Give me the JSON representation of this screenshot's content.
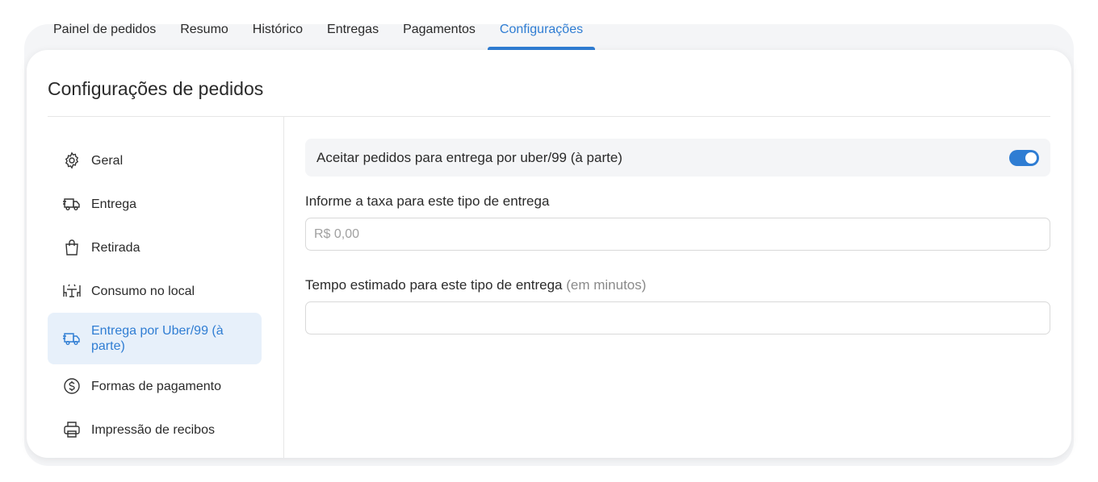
{
  "tabs": [
    {
      "label": "Painel de pedidos",
      "active": false
    },
    {
      "label": "Resumo",
      "active": false
    },
    {
      "label": "Histórico",
      "active": false
    },
    {
      "label": "Entregas",
      "active": false
    },
    {
      "label": "Pagamentos",
      "active": false
    },
    {
      "label": "Configurações",
      "active": true
    }
  ],
  "page": {
    "title": "Configurações de pedidos"
  },
  "menu": [
    {
      "label": "Geral",
      "icon": "gear-icon"
    },
    {
      "label": "Entrega",
      "icon": "delivery-truck-icon"
    },
    {
      "label": "Retirada",
      "icon": "shopping-bag-icon"
    },
    {
      "label": "Consumo no local",
      "icon": "table-chairs-icon"
    },
    {
      "label": "Entrega por Uber/99 (à parte)",
      "icon": "delivery-truck-icon",
      "active": true
    },
    {
      "label": "Formas de pagamento",
      "icon": "dollar-circle-icon"
    },
    {
      "label": "Impressão de recibos",
      "icon": "printer-icon"
    }
  ],
  "content": {
    "toggle_label": "Aceitar pedidos para entrega por uber/99 (à parte)",
    "toggle_on": true,
    "fee_label": "Informe a taxa para este tipo de entrega",
    "fee_value": "",
    "fee_placeholder": "R$ 0,00",
    "time_label": "Tempo estimado para este tipo de entrega",
    "time_hint": "(em minutos)",
    "time_value": ""
  },
  "colors": {
    "accent": "#2f7dd3",
    "active_bg": "#e7f0fa",
    "panel_bg": "#f4f5f7"
  }
}
